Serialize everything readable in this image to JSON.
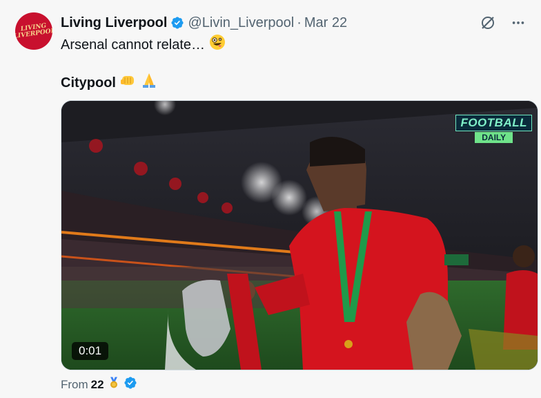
{
  "author": {
    "display_name": "Living Liverpool",
    "handle": "@Livin_Liverpool",
    "date": "Mar 22",
    "avatar_text": "LIVING LIVERPOOL"
  },
  "tweet": {
    "text_line1": "Arsenal cannot relate…",
    "text_line2": "Citypool",
    "emojis": [
      "zany-face",
      "oncoming-fist",
      "folded-hands"
    ]
  },
  "media": {
    "timestamp": "0:01",
    "brand_top": "FOOTBALL",
    "brand_bottom": "DAILY"
  },
  "footer": {
    "prefix": "From",
    "source": "22",
    "badge": "medal-icon"
  },
  "colors": {
    "verified": "#1d9bf0",
    "avatar": "#c8102e",
    "muted": "#536471"
  }
}
